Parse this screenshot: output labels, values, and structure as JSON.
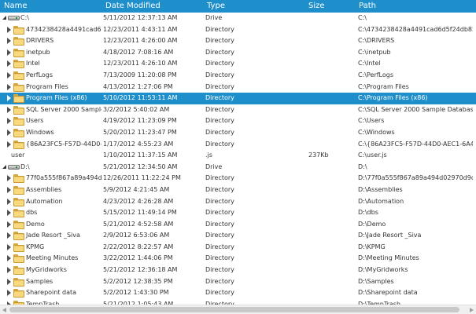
{
  "columns": {
    "name": "Name",
    "date": "Date Modified",
    "type": "Type",
    "size": "Size",
    "path": "Path"
  },
  "colors": {
    "header_bg": "#1f8fcb",
    "selection_bg": "#1f8fcb",
    "folder": "#f0c861"
  },
  "rows": [
    {
      "level": 0,
      "icon": "drive-icon",
      "expander": "expanded",
      "name": "C:\\",
      "date": "5/11/2012 12:37:13 AM",
      "type": "Drive",
      "size": "",
      "path": "C:\\"
    },
    {
      "level": 1,
      "icon": "folder-icon",
      "expander": "collapsed",
      "name": "4734238428a4491cad6d5f...",
      "date": "12/23/2011 4:43:11 AM",
      "type": "Directory",
      "size": "",
      "path": "C:\\4734238428a4491cad6d5f24db85..."
    },
    {
      "level": 1,
      "icon": "folder-icon",
      "expander": "collapsed",
      "name": "DRIVERS",
      "date": "12/23/2011 4:26:00 AM",
      "type": "Directory",
      "size": "",
      "path": "C:\\DRIVERS"
    },
    {
      "level": 1,
      "icon": "folder-icon",
      "expander": "collapsed",
      "name": "inetpub",
      "date": "4/18/2012 7:08:16 AM",
      "type": "Directory",
      "size": "",
      "path": "C:\\inetpub"
    },
    {
      "level": 1,
      "icon": "folder-icon",
      "expander": "collapsed",
      "name": "Intel",
      "date": "12/23/2011 4:26:10 AM",
      "type": "Directory",
      "size": "",
      "path": "C:\\Intel"
    },
    {
      "level": 1,
      "icon": "folder-icon",
      "expander": "collapsed",
      "name": "PerfLogs",
      "date": "7/13/2009 11:20:08 PM",
      "type": "Directory",
      "size": "",
      "path": "C:\\PerfLogs"
    },
    {
      "level": 1,
      "icon": "folder-icon",
      "expander": "collapsed",
      "name": "Program Files",
      "date": "4/13/2012 1:27:06 PM",
      "type": "Directory",
      "size": "",
      "path": "C:\\Program Files"
    },
    {
      "level": 1,
      "icon": "folder-icon",
      "expander": "collapsed",
      "name": "Program Files (x86)",
      "date": "5/10/2012 11:53:11 AM",
      "type": "Directory",
      "size": "",
      "path": "C:\\Program Files (x86)",
      "selected": true
    },
    {
      "level": 1,
      "icon": "folder-icon",
      "expander": "collapsed",
      "name": "SQL Server 2000 Sample D...",
      "date": "3/2/2012 5:40:02 AM",
      "type": "Directory",
      "size": "",
      "path": "C:\\SQL Server 2000 Sample Databases"
    },
    {
      "level": 1,
      "icon": "folder-icon",
      "expander": "collapsed",
      "name": "Users",
      "date": "4/19/2012 11:23:09 PM",
      "type": "Directory",
      "size": "",
      "path": "C:\\Users"
    },
    {
      "level": 1,
      "icon": "folder-icon",
      "expander": "collapsed",
      "name": "Windows",
      "date": "5/20/2012 11:23:47 PM",
      "type": "Directory",
      "size": "",
      "path": "C:\\Windows"
    },
    {
      "level": 1,
      "icon": "folder-icon",
      "expander": "collapsed",
      "name": "{86A23FC5-F57D-44D0-AE1...",
      "date": "1/17/2012 4:55:23 AM",
      "type": "Directory",
      "size": "",
      "path": "C:\\{86A23FC5-F57D-44D0-AEC1-6A4..."
    },
    {
      "level": 1,
      "icon": "",
      "expander": "",
      "name": "user",
      "date": "1/10/2012 11:37:15 AM",
      "type": ".js",
      "size": "237Kb",
      "path": "C:\\user.js"
    },
    {
      "level": 0,
      "icon": "drive-icon",
      "expander": "expanded",
      "name": "D:\\",
      "date": "5/21/2012 12:34:50 AM",
      "type": "Drive",
      "size": "",
      "path": "D:\\"
    },
    {
      "level": 1,
      "icon": "folder-icon",
      "expander": "collapsed",
      "name": "77f0a555f867a89a494d029...",
      "date": "12/26/2011 11:22:24 PM",
      "type": "Directory",
      "size": "",
      "path": "D:\\77f0a555f867a89a494d02970d9df..."
    },
    {
      "level": 1,
      "icon": "folder-icon",
      "expander": "collapsed",
      "name": "Assemblies",
      "date": "5/9/2012 4:21:45 AM",
      "type": "Directory",
      "size": "",
      "path": "D:\\Assemblies"
    },
    {
      "level": 1,
      "icon": "folder-icon",
      "expander": "collapsed",
      "name": "Automation",
      "date": "4/23/2012 4:26:28 AM",
      "type": "Directory",
      "size": "",
      "path": "D:\\Automation"
    },
    {
      "level": 1,
      "icon": "folder-icon",
      "expander": "collapsed",
      "name": "dbs",
      "date": "5/15/2012 11:49:14 PM",
      "type": "Directory",
      "size": "",
      "path": "D:\\dbs"
    },
    {
      "level": 1,
      "icon": "folder-icon",
      "expander": "collapsed",
      "name": "Demo",
      "date": "5/21/2012 4:52:58 AM",
      "type": "Directory",
      "size": "",
      "path": "D:\\Demo"
    },
    {
      "level": 1,
      "icon": "folder-icon",
      "expander": "collapsed",
      "name": "Jade Resort _Siva",
      "date": "2/9/2012 6:53:06 AM",
      "type": "Directory",
      "size": "",
      "path": "D:\\Jade Resort _Siva"
    },
    {
      "level": 1,
      "icon": "folder-icon",
      "expander": "collapsed",
      "name": "KPMG",
      "date": "2/22/2012 8:22:57 AM",
      "type": "Directory",
      "size": "",
      "path": "D:\\KPMG"
    },
    {
      "level": 1,
      "icon": "folder-icon",
      "expander": "collapsed",
      "name": "Meeting Minutes",
      "date": "3/22/2012 1:44:06 PM",
      "type": "Directory",
      "size": "",
      "path": "D:\\Meeting Minutes"
    },
    {
      "level": 1,
      "icon": "folder-icon",
      "expander": "collapsed",
      "name": "MyGridworks",
      "date": "5/21/2012 12:36:18 AM",
      "type": "Directory",
      "size": "",
      "path": "D:\\MyGridworks"
    },
    {
      "level": 1,
      "icon": "folder-icon",
      "expander": "collapsed",
      "name": "Samples",
      "date": "5/2/2012 12:38:35 PM",
      "type": "Directory",
      "size": "",
      "path": "D:\\Samples"
    },
    {
      "level": 1,
      "icon": "folder-icon",
      "expander": "collapsed",
      "name": "Sharepoint data",
      "date": "5/2/2012 1:43:30 PM",
      "type": "Directory",
      "size": "",
      "path": "D:\\Sharepoint data"
    },
    {
      "level": 1,
      "icon": "folder-icon",
      "expander": "collapsed",
      "name": "TempTrash",
      "date": "5/21/2012 1:05:43 AM",
      "type": "Directory",
      "size": "",
      "path": "D:\\TempTrash"
    }
  ]
}
